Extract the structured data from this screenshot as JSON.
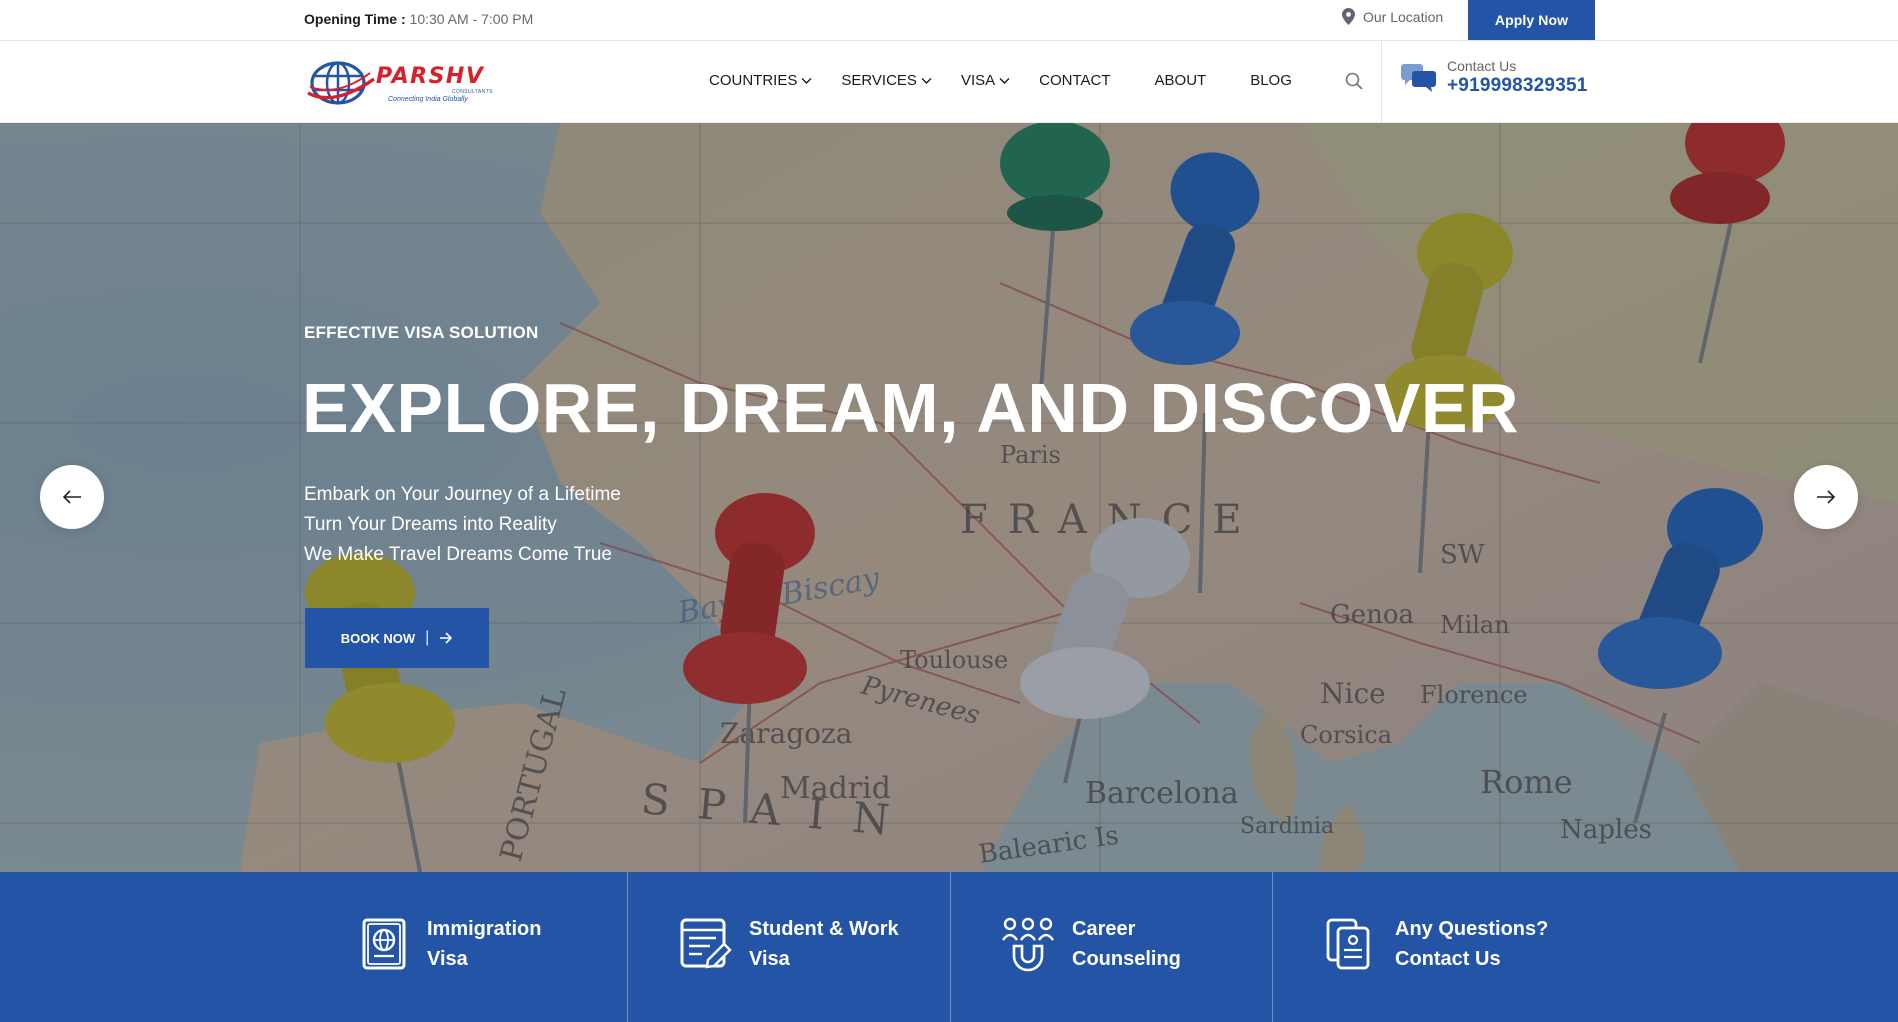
{
  "topbar": {
    "opening_label": "Opening Time :",
    "opening_hours": "10:30 AM - 7:00 PM",
    "location_label": "Our Location",
    "apply_label": "Apply Now"
  },
  "header": {
    "logo_brand": "PARSHV",
    "logo_sub": "CONSULTANTS",
    "logo_tagline": "Connecting India Globally",
    "nav": [
      {
        "label": "COUNTRIES",
        "dropdown": true
      },
      {
        "label": "SERVICES",
        "dropdown": true
      },
      {
        "label": "VISA",
        "dropdown": true
      },
      {
        "label": "CONTACT",
        "dropdown": false
      },
      {
        "label": "ABOUT",
        "dropdown": false
      },
      {
        "label": "BLOG",
        "dropdown": false
      }
    ],
    "contact_label": "Contact Us",
    "contact_phone": "+919998329351"
  },
  "hero": {
    "eyebrow": "EFFECTIVE VISA SOLUTION",
    "headline": "EXPLORE, DREAM, AND DISCOVER",
    "lines": [
      "Embark on Your Journey of a Lifetime",
      "Turn Your Dreams into Reality",
      "We Make Travel Dreams Come True"
    ],
    "book_label": "BOOK NOW",
    "map_labels": [
      "FRANCE",
      "SPAIN",
      "Madrid",
      "Zaragoza",
      "Barcelona",
      "Corsica",
      "Rome",
      "Nice",
      "Genoa",
      "Sardinia",
      "Naples",
      "Balearic Is",
      "Paris",
      "Milan",
      "Florence",
      "Toulouse",
      "Bay of Biscay",
      "Pyrenees",
      "PORTUGAL",
      "SW"
    ]
  },
  "features": [
    {
      "line1": "Immigration",
      "line2": "Visa",
      "icon": "passport-icon"
    },
    {
      "line1": "Student & Work",
      "line2": "Visa",
      "icon": "document-pen-icon"
    },
    {
      "line1": "Career",
      "line2": "Counseling",
      "icon": "career-group-icon"
    },
    {
      "line1": "Any Questions?",
      "line2": "Contact Us",
      "icon": "contact-card-icon"
    }
  ],
  "colors": {
    "brand_blue": "#2454a6",
    "brand_red": "#d81f2c"
  }
}
